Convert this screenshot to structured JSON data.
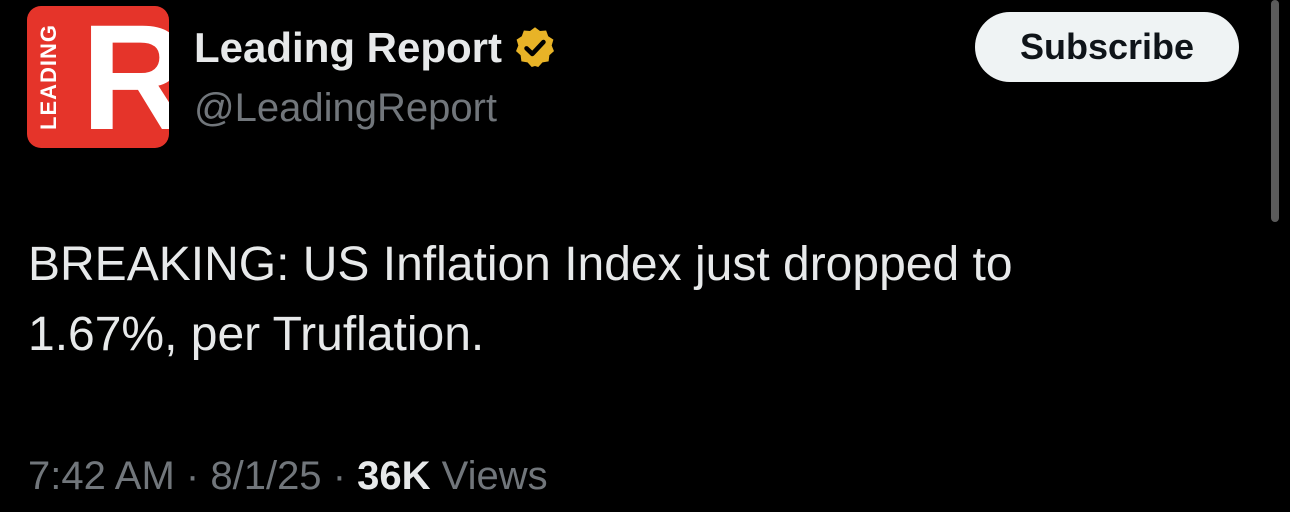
{
  "account": {
    "avatar_logo_letter": "R",
    "avatar_logo_side_text": "LEADING",
    "display_name": "Leading Report",
    "verified": true,
    "handle": "@LeadingReport"
  },
  "actions": {
    "subscribe_label": "Subscribe"
  },
  "tweet": {
    "text_line1": "BREAKING: US Inflation Index just dropped to",
    "text_line2": "1.67%, per Truflation."
  },
  "meta": {
    "time": "7:42 AM",
    "separator": "·",
    "date": "8/1/25",
    "views_count": "36K",
    "views_label": "Views"
  },
  "colors": {
    "background": "#000000",
    "primary_text": "#e7e9ea",
    "secondary_text": "#71767b",
    "avatar_red": "#e5342a",
    "verified_gold": "#e8b327",
    "subscribe_bg": "#eff3f4"
  },
  "icons": {
    "verified": "verified-badge-icon"
  }
}
